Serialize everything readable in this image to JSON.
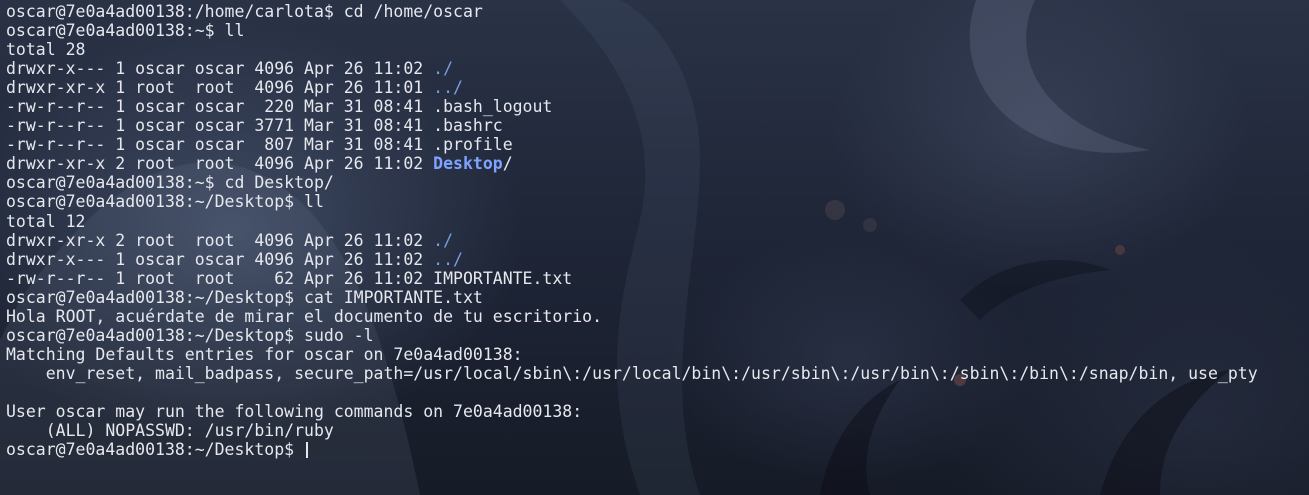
{
  "terminal": {
    "lines": [
      {
        "text": "oscar@7e0a4ad00138:/home/carlota$ cd /home/oscar"
      },
      {
        "text": "oscar@7e0a4ad00138:~$ ll"
      },
      {
        "text": "total 28"
      },
      {
        "text": "drwxr-x--- 1 oscar oscar 4096 Apr 26 11:02 ",
        "name": "./"
      },
      {
        "text": "drwxr-xr-x 1 root  root  4096 Apr 26 11:01 ",
        "name": "../"
      },
      {
        "text": "-rw-r--r-- 1 oscar oscar  220 Mar 31 08:41 .bash_logout"
      },
      {
        "text": "-rw-r--r-- 1 oscar oscar 3771 Mar 31 08:41 .bashrc"
      },
      {
        "text": "-rw-r--r-- 1 oscar oscar  807 Mar 31 08:41 .profile"
      },
      {
        "text": "drwxr-xr-x 2 root  root  4096 Apr 26 11:02 ",
        "dirname": "Desktop",
        "suffix": "/"
      },
      {
        "text": "oscar@7e0a4ad00138:~$ cd Desktop/"
      },
      {
        "text": "oscar@7e0a4ad00138:~/Desktop$ ll"
      },
      {
        "text": "total 12"
      },
      {
        "text": "drwxr-xr-x 2 root  root  4096 Apr 26 11:02 ",
        "name": "./"
      },
      {
        "text": "drwxr-x--- 1 oscar oscar 4096 Apr 26 11:02 ",
        "name": "../"
      },
      {
        "text": "-rw-r--r-- 1 root  root    62 Apr 26 11:02 IMPORTANTE.txt"
      },
      {
        "text": "oscar@7e0a4ad00138:~/Desktop$ cat IMPORTANTE.txt"
      },
      {
        "text": "Hola ROOT, acuérdate de mirar el documento de tu escritorio."
      },
      {
        "text": "oscar@7e0a4ad00138:~/Desktop$ sudo -l"
      },
      {
        "text": "Matching Defaults entries for oscar on 7e0a4ad00138:"
      },
      {
        "text": "    env_reset, mail_badpass, secure_path=/usr/local/sbin\\:/usr/local/bin\\:/usr/sbin\\:/usr/bin\\:/sbin\\:/bin\\:/snap/bin, use_pty"
      },
      {
        "text": ""
      },
      {
        "text": "User oscar may run the following commands on 7e0a4ad00138:"
      },
      {
        "text": "    (ALL) NOPASSWD: /usr/bin/ruby"
      }
    ],
    "prompt": "oscar@7e0a4ad00138:~/Desktop$ ",
    "colors": {
      "foreground": "#e6e8ee",
      "directory": "#7a9fe0",
      "directory_bold": "#7fa3ff"
    }
  }
}
